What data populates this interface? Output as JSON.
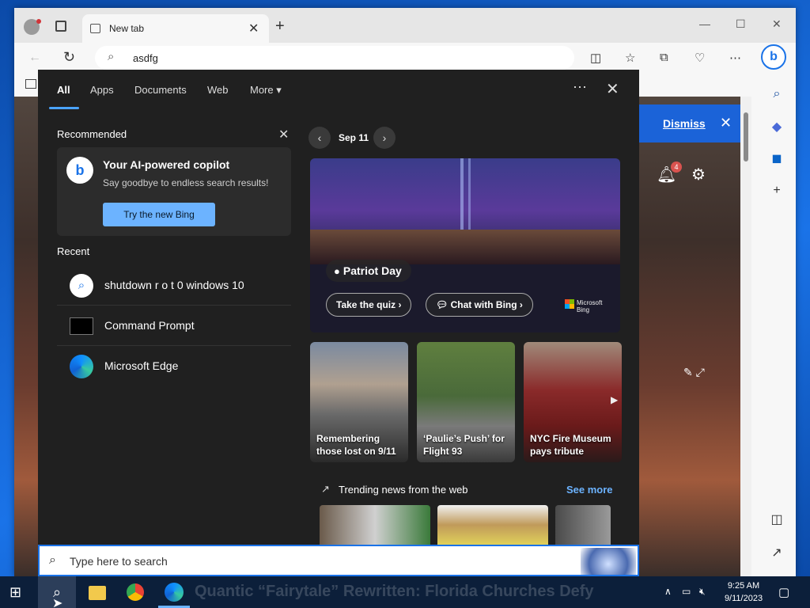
{
  "browser": {
    "tab_title": "New tab",
    "address_text": "asdfg"
  },
  "newtab_page": {
    "dismiss_label": "Dismiss",
    "notification_count": "4"
  },
  "search_flyout": {
    "tabs": [
      "All",
      "Apps",
      "Documents",
      "Web",
      "More"
    ],
    "recommended": {
      "heading": "Recommended",
      "card_title": "Your AI-powered copilot",
      "card_subtitle": "Say goodbye to endless search results!",
      "card_button": "Try the new Bing"
    },
    "recent": {
      "heading": "Recent",
      "items": [
        {
          "label": "shutdown r o t 0 windows 10",
          "icon": "search-icon"
        },
        {
          "label": "Command Prompt",
          "icon": "command-prompt-icon"
        },
        {
          "label": "Microsoft Edge",
          "icon": "edge-icon"
        }
      ]
    },
    "highlight": {
      "date": "Sep 11",
      "title": "Patriot Day",
      "quiz_button": "Take the quiz",
      "chat_button": "Chat with Bing",
      "brand_line1": "Microsoft",
      "brand_line2": "Bing"
    },
    "news_cards": [
      {
        "caption": "Remembering those lost on 9/11"
      },
      {
        "caption": "‘Paulie’s Push’ for Flight 93"
      },
      {
        "caption": "NYC Fire Museum pays tribute"
      }
    ],
    "trending": {
      "heading": "Trending news from the web",
      "see_more": "See more"
    }
  },
  "taskbar": {
    "search_placeholder": "Type here to search",
    "headline_ghost": "Quantic “Fairytale” Rewritten: Florida Churches Defy",
    "time": "9:25 AM",
    "date": "9/11/2023"
  },
  "colors": {
    "accent": "#1a73e8",
    "link": "#6cb3ff",
    "flyout_bg": "#202020"
  }
}
